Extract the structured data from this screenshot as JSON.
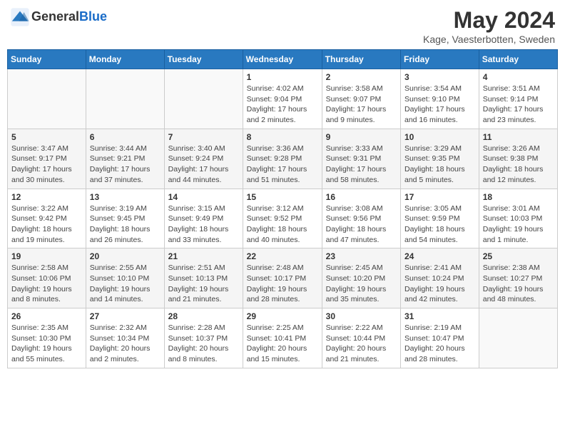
{
  "header": {
    "logo_line1": "General",
    "logo_line2": "Blue",
    "month": "May 2024",
    "location": "Kage, Vaesterbotten, Sweden"
  },
  "weekdays": [
    "Sunday",
    "Monday",
    "Tuesday",
    "Wednesday",
    "Thursday",
    "Friday",
    "Saturday"
  ],
  "weeks": [
    [
      {
        "day": "",
        "info": ""
      },
      {
        "day": "",
        "info": ""
      },
      {
        "day": "",
        "info": ""
      },
      {
        "day": "1",
        "info": "Sunrise: 4:02 AM\nSunset: 9:04 PM\nDaylight: 17 hours\nand 2 minutes."
      },
      {
        "day": "2",
        "info": "Sunrise: 3:58 AM\nSunset: 9:07 PM\nDaylight: 17 hours\nand 9 minutes."
      },
      {
        "day": "3",
        "info": "Sunrise: 3:54 AM\nSunset: 9:10 PM\nDaylight: 17 hours\nand 16 minutes."
      },
      {
        "day": "4",
        "info": "Sunrise: 3:51 AM\nSunset: 9:14 PM\nDaylight: 17 hours\nand 23 minutes."
      }
    ],
    [
      {
        "day": "5",
        "info": "Sunrise: 3:47 AM\nSunset: 9:17 PM\nDaylight: 17 hours\nand 30 minutes."
      },
      {
        "day": "6",
        "info": "Sunrise: 3:44 AM\nSunset: 9:21 PM\nDaylight: 17 hours\nand 37 minutes."
      },
      {
        "day": "7",
        "info": "Sunrise: 3:40 AM\nSunset: 9:24 PM\nDaylight: 17 hours\nand 44 minutes."
      },
      {
        "day": "8",
        "info": "Sunrise: 3:36 AM\nSunset: 9:28 PM\nDaylight: 17 hours\nand 51 minutes."
      },
      {
        "day": "9",
        "info": "Sunrise: 3:33 AM\nSunset: 9:31 PM\nDaylight: 17 hours\nand 58 minutes."
      },
      {
        "day": "10",
        "info": "Sunrise: 3:29 AM\nSunset: 9:35 PM\nDaylight: 18 hours\nand 5 minutes."
      },
      {
        "day": "11",
        "info": "Sunrise: 3:26 AM\nSunset: 9:38 PM\nDaylight: 18 hours\nand 12 minutes."
      }
    ],
    [
      {
        "day": "12",
        "info": "Sunrise: 3:22 AM\nSunset: 9:42 PM\nDaylight: 18 hours\nand 19 minutes."
      },
      {
        "day": "13",
        "info": "Sunrise: 3:19 AM\nSunset: 9:45 PM\nDaylight: 18 hours\nand 26 minutes."
      },
      {
        "day": "14",
        "info": "Sunrise: 3:15 AM\nSunset: 9:49 PM\nDaylight: 18 hours\nand 33 minutes."
      },
      {
        "day": "15",
        "info": "Sunrise: 3:12 AM\nSunset: 9:52 PM\nDaylight: 18 hours\nand 40 minutes."
      },
      {
        "day": "16",
        "info": "Sunrise: 3:08 AM\nSunset: 9:56 PM\nDaylight: 18 hours\nand 47 minutes."
      },
      {
        "day": "17",
        "info": "Sunrise: 3:05 AM\nSunset: 9:59 PM\nDaylight: 18 hours\nand 54 minutes."
      },
      {
        "day": "18",
        "info": "Sunrise: 3:01 AM\nSunset: 10:03 PM\nDaylight: 19 hours\nand 1 minute."
      }
    ],
    [
      {
        "day": "19",
        "info": "Sunrise: 2:58 AM\nSunset: 10:06 PM\nDaylight: 19 hours\nand 8 minutes."
      },
      {
        "day": "20",
        "info": "Sunrise: 2:55 AM\nSunset: 10:10 PM\nDaylight: 19 hours\nand 14 minutes."
      },
      {
        "day": "21",
        "info": "Sunrise: 2:51 AM\nSunset: 10:13 PM\nDaylight: 19 hours\nand 21 minutes."
      },
      {
        "day": "22",
        "info": "Sunrise: 2:48 AM\nSunset: 10:17 PM\nDaylight: 19 hours\nand 28 minutes."
      },
      {
        "day": "23",
        "info": "Sunrise: 2:45 AM\nSunset: 10:20 PM\nDaylight: 19 hours\nand 35 minutes."
      },
      {
        "day": "24",
        "info": "Sunrise: 2:41 AM\nSunset: 10:24 PM\nDaylight: 19 hours\nand 42 minutes."
      },
      {
        "day": "25",
        "info": "Sunrise: 2:38 AM\nSunset: 10:27 PM\nDaylight: 19 hours\nand 48 minutes."
      }
    ],
    [
      {
        "day": "26",
        "info": "Sunrise: 2:35 AM\nSunset: 10:30 PM\nDaylight: 19 hours\nand 55 minutes."
      },
      {
        "day": "27",
        "info": "Sunrise: 2:32 AM\nSunset: 10:34 PM\nDaylight: 20 hours\nand 2 minutes."
      },
      {
        "day": "28",
        "info": "Sunrise: 2:28 AM\nSunset: 10:37 PM\nDaylight: 20 hours\nand 8 minutes."
      },
      {
        "day": "29",
        "info": "Sunrise: 2:25 AM\nSunset: 10:41 PM\nDaylight: 20 hours\nand 15 minutes."
      },
      {
        "day": "30",
        "info": "Sunrise: 2:22 AM\nSunset: 10:44 PM\nDaylight: 20 hours\nand 21 minutes."
      },
      {
        "day": "31",
        "info": "Sunrise: 2:19 AM\nSunset: 10:47 PM\nDaylight: 20 hours\nand 28 minutes."
      },
      {
        "day": "",
        "info": ""
      }
    ]
  ]
}
